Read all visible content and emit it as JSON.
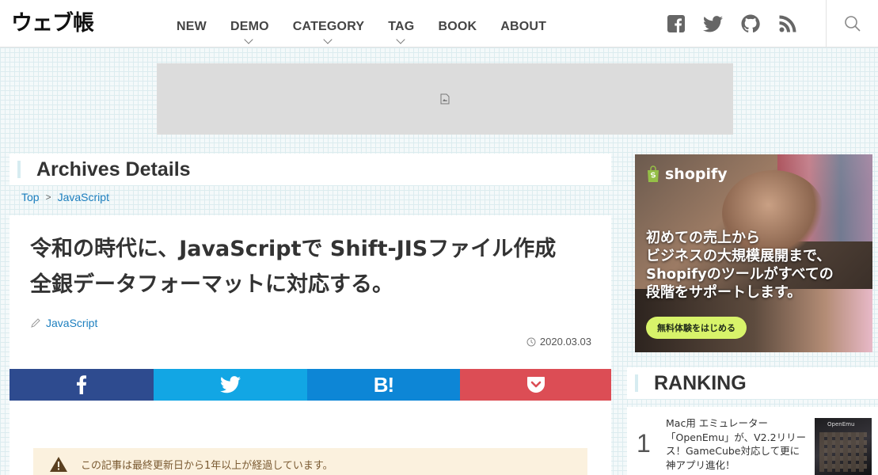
{
  "header": {
    "logo": "ウェブ帳",
    "nav": [
      {
        "label": "NEW",
        "dropdown": false
      },
      {
        "label": "DEMO",
        "dropdown": true
      },
      {
        "label": "CATEGORY",
        "dropdown": true
      },
      {
        "label": "TAG",
        "dropdown": true
      },
      {
        "label": "BOOK",
        "dropdown": false
      },
      {
        "label": "ABOUT",
        "dropdown": false
      }
    ],
    "social": [
      "facebook-icon",
      "twitter-icon",
      "github-icon",
      "rss-icon"
    ],
    "search_icon": "search-icon"
  },
  "ad": {
    "icon": "broken-image-icon"
  },
  "archive": {
    "title": "Archives Details"
  },
  "breadcrumb": {
    "items": [
      "Top",
      "JavaScript"
    ],
    "separator": ">"
  },
  "article": {
    "title": "令和の時代に、JavaScriptで Shift-JISファイル作成 全銀データフォーマットに対応する。",
    "category": "JavaScript",
    "date": "2020.03.03"
  },
  "share": {
    "facebook_color": "#2e4b8f",
    "twitter_color": "#12a6e4",
    "hatena_label": "B!",
    "hatena_color": "#0d86d6",
    "pocket_color": "#dc4d55"
  },
  "notice": {
    "text": "この記事は最終更新日から1年以上が経過しています。"
  },
  "sidebar": {
    "shopify": {
      "brand": "shopify",
      "lines": [
        "初めての売上から",
        "ビジネスの大規模展開まで、",
        "Shopifyのツールがすべての",
        "段階をサポートします。"
      ],
      "cta": "無料体験をはじめる"
    },
    "ranking": {
      "title": "RANKING",
      "items": [
        {
          "rank": "1",
          "text": "Mac用 エミュレーター「OpenEmu」が、V2.2リリース！GameCube対応して更に神アプリ進化！",
          "thumb_label": "OpenEmu"
        }
      ]
    }
  }
}
